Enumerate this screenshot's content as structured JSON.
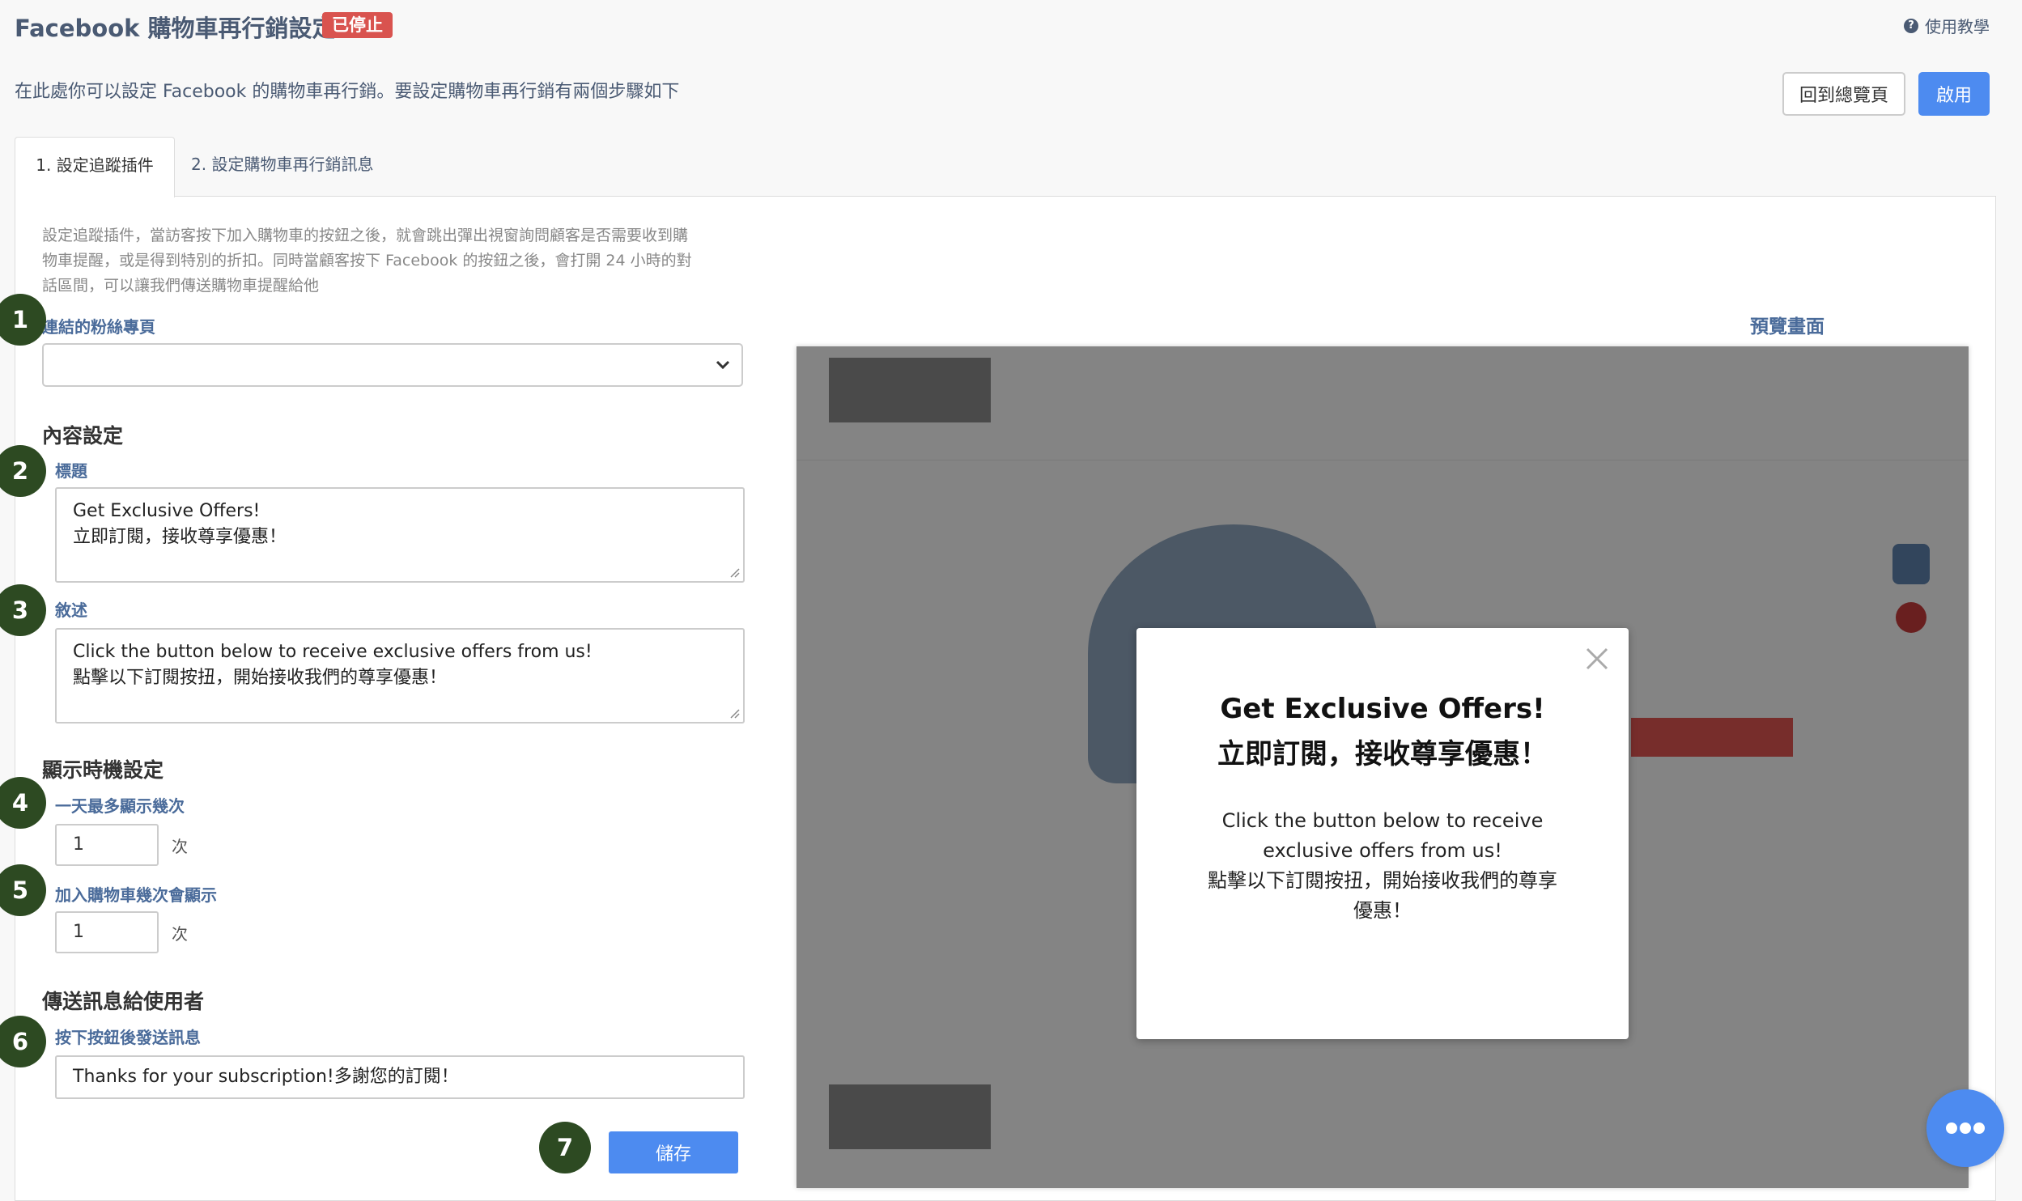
{
  "header": {
    "title": "Facebook 購物車再行銷設定",
    "status_badge": "已停止",
    "help_icon": "?",
    "help_label": "使用教學",
    "subtitle": "在此處你可以設定 Facebook 的購物車再行銷。要設定購物車再行銷有兩個步驟如下",
    "back_button": "回到總覽頁",
    "enable_button": "啟用"
  },
  "tabs": [
    {
      "label": "1. 設定追蹤插件",
      "active": true
    },
    {
      "label": "2. 設定購物車再行銷訊息",
      "active": false
    }
  ],
  "form": {
    "description": "設定追蹤插件，當訪客按下加入購物車的按鈕之後，就會跳出彈出視窗詢問顧客是否需要收到購物車提醒，或是得到特別的折扣。同時當顧客按下 Facebook 的按鈕之後，會打開 24 小時的對話區間，可以讓我們傳送購物車提醒給他",
    "fanpage_label": "連結的粉絲專頁",
    "fanpage_value": "",
    "content_section": "內容設定",
    "title_label": "標題",
    "title_value": "Get Exclusive Offers!\n立即訂閱，接收尊享優惠！",
    "desc_label": "敘述",
    "desc_value": "Click the button below to receive exclusive offers from us!\n點擊以下訂閱按扭，開始接收我們的尊享優惠！",
    "timing_section": "顯示時機設定",
    "max_per_day_label": "一天最多顯示幾次",
    "max_per_day_value": "1",
    "unit_times": "次",
    "cart_count_label": "加入購物車幾次會顯示",
    "cart_count_value": "1",
    "message_section": "傳送訊息給使用者",
    "message_label": "按下按鈕後發送訊息",
    "message_value": "Thanks for your subscription!多謝您的訂閱！",
    "save_button": "儲存"
  },
  "steps": [
    "1",
    "2",
    "3",
    "4",
    "5",
    "6",
    "7"
  ],
  "preview": {
    "label": "預覽畫面",
    "modal_title": "Get Exclusive Offers!\n立即訂閱，接收尊享優惠！",
    "modal_body": "Click the button below to receive exclusive offers from us!\n點擊以下訂閱按扭，開始接收我們的尊享優惠！"
  },
  "colors": {
    "primary": "#4d8bf0",
    "danger": "#d9534f",
    "step_circle": "#2d4a22",
    "label_blue": "#4a6b9a"
  }
}
